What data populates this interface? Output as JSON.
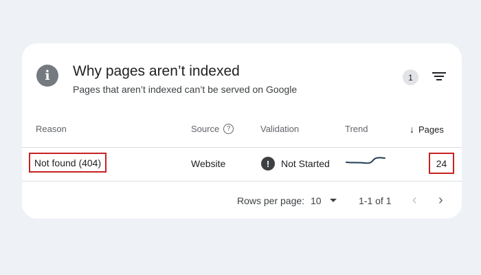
{
  "header": {
    "title": "Why pages aren’t indexed",
    "subtitle": "Pages that aren’t indexed can’t be served on Google",
    "info_icon": "info-icon",
    "info_glyph": "i",
    "filter_count": "1",
    "filter_icon": "filter-icon"
  },
  "table": {
    "columns": {
      "reason": "Reason",
      "source": "Source",
      "validation": "Validation",
      "trend": "Trend",
      "pages": "Pages"
    },
    "help_glyph": "?",
    "sort_glyph": "↓",
    "rows": [
      {
        "reason": "Not found (404)",
        "source": "Website",
        "validation": "Not Started",
        "validation_glyph": "!",
        "trend_icon": "sparkline",
        "pages": "24"
      }
    ]
  },
  "pagination": {
    "rows_per_page_label": "Rows per page:",
    "rows_per_page_value": "10",
    "range": "1-1 of 1",
    "prev_glyph": "‹",
    "next_glyph": "›"
  },
  "colors": {
    "background": "#eef1f6",
    "card": "#ffffff",
    "highlight_border": "#c5221f",
    "trend_line": "#1f3b57"
  }
}
